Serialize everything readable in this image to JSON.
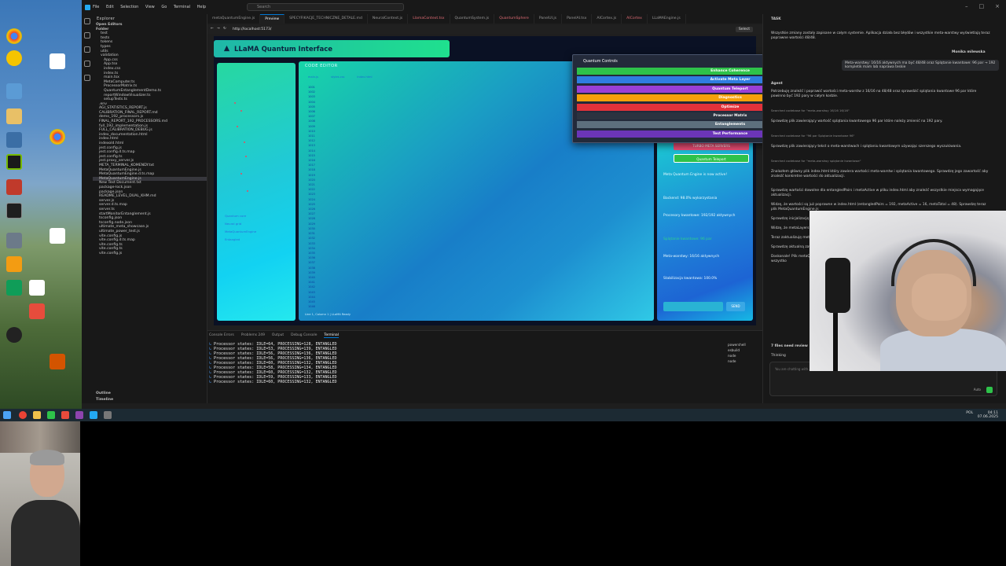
{
  "window": {
    "menu": [
      "File",
      "Edit",
      "Selection",
      "View",
      "Go",
      "Terminal",
      "Help"
    ],
    "search_placeholder": "Search"
  },
  "explorer": {
    "title": "Explorer",
    "open_editors": "Open Editors",
    "folder": "Folder",
    "files": [
      "test",
      "tests",
      "tokens",
      "types",
      "utils",
      "validation",
      "App.css",
      "App.tsx",
      "index.css",
      "index.ts",
      "main.tsx",
      "MetaComputer.ts",
      "ProcessorMatrix.ts",
      "QuantumEntanglementDemo.ts",
      "reportWindowVisualizer.ts",
      "setupTests.ts",
      ".env",
      "AGI_STATISTICS_REPORT.js",
      "CALIBRATION_FINAL_REPORT.md",
      "demo_192_processors.js",
      "FINAL_REPORT_192_PROCESSORS.md",
      "full_192_implementation.js",
      "FULL_CALIBRATION_DEBUG.js",
      "index_documentation.html",
      "index.html",
      "indexold.html",
      "jest.config.js",
      "jest.config.d.ts.map",
      "jest.config.ts",
      "jest.proxy_server.js",
      "META_TERMINAL_KOMENDY.txt",
      "MetaQuantumEngine.js",
      "MetaQuantumEngine.d.ts.map",
      "MetaQuantumEngine.js",
      "New Text Document.txt",
      "package-lock.json",
      "package.json",
      "README_LEVEL_DUAL_KHM.md",
      "server.js",
      "server.d.ts.map",
      "server.ts",
      "startMonitorEntanglement.js",
      "tsconfig.json",
      "tsconfig.node.json",
      "ultimate_meta_showcase.js",
      "ultimate_power_test.js",
      "vite.config.js",
      "vite.config.d.ts.map",
      "vite.config.ts",
      "vite.config.ts",
      "vite.config.js"
    ],
    "outline": "Outline",
    "timeline": "Timeline"
  },
  "tabs": [
    "metaQuantumEngine.js",
    "Preview",
    "SPECYFIKACJE_TECHNICZNE_DETALE.md",
    "NeuralContext.js",
    "LlamaContext.tsx",
    "QuantumSystem.js",
    "QuantumSphere",
    "PanelUI.js",
    "PanelAI.tsx",
    "AICortex.js",
    "AICortex",
    "LLaMAEngine.js"
  ],
  "browser": {
    "url": "http://localhost:5173/",
    "select_label": "Select"
  },
  "app": {
    "title": "LLaMA Quantum Interface",
    "code_editor_title": "CODE EDITOR",
    "code_editor_tabs": [
      "main.js",
      "styles.css",
      "index.html"
    ],
    "line_numbers": [
      "1001",
      "1002",
      "1003",
      "1004",
      "1005",
      "1006",
      "1007",
      "1008",
      "1009",
      "1010",
      "1011",
      "1012",
      "1013",
      "1014",
      "1015",
      "1016",
      "1017",
      "1018",
      "1019",
      "1020",
      "1021",
      "1022",
      "1023",
      "1024",
      "1025",
      "1026",
      "1027",
      "1028",
      "1029",
      "1030",
      "1031",
      "1032",
      "1033",
      "1034",
      "1035",
      "1036",
      "1037",
      "1038",
      "1039",
      "1040",
      "1041",
      "1042",
      "1043",
      "1044",
      "1045",
      "1046"
    ],
    "status": "Line 1, Column 1 | LLaMA Ready",
    "left_labels": [
      "Quantum core",
      "Neural grid",
      "MetaQuantumEngine",
      "Entangled"
    ],
    "right_panel": {
      "buttons": [
        "TURBO MODE AUTO",
        "TURBO META SERVERS",
        "Quantum Teleport"
      ],
      "items": [
        "Meta Quantum Engine is now active!",
        "Backend: 98.0% wykorzystania",
        "Procesory kwantowe: 192/192 aktywnych",
        "Splątanie kwantowe: 96 par",
        "Meta-warstwy: 16/16 aktywnych",
        "Stabilizacja kwantowa: 100.0%"
      ],
      "send": "SEND"
    }
  },
  "quantum_controls": {
    "title": "Quantum Controls",
    "items": [
      {
        "label": "Enhance Coherence",
        "color": "#2ec24a"
      },
      {
        "label": "Activate Meta Layer",
        "color": "#2f7de0"
      },
      {
        "label": "Quantum Teleport",
        "color": "#9a3fd6"
      },
      {
        "label": "Diagnostics",
        "color": "#f5a00b"
      },
      {
        "label": "Optimize",
        "color": "#e2323a"
      },
      {
        "label": "Processor Matrix",
        "color": "#2c3340"
      },
      {
        "label": "Entanglements",
        "color": "#5d6f7d"
      },
      {
        "label": "Test Performance",
        "color": "#6b35b8"
      }
    ]
  },
  "panel": {
    "tabs": [
      "Console Errors",
      "Problems",
      "Output",
      "Debug Console",
      "Terminal"
    ],
    "problems_count": "249",
    "terminal_lines": [
      "Processor states: IDLE=64, PROCESSING=128, ENTANGLED",
      "Processor states: IDLE=53, PROCESSING=139, ENTANGLED",
      "Processor states: IDLE=56, PROCESSING=136, ENTANGLED",
      "Processor states: IDLE=56, PROCESSING=136, ENTANGLED",
      "Processor states: IDLE=60, PROCESSING=132, ENTANGLED",
      "Processor states: IDLE=58, PROCESSING=134, ENTANGLED",
      "Processor states: IDLE=60, PROCESSING=132, ENTANGLED",
      "Processor states: IDLE=59, PROCESSING=133, ENTANGLED",
      "Processor states: IDLE=60, PROCESSING=132, ENTANGLED"
    ],
    "terminal_list": [
      "powershell",
      "esbuild",
      "node",
      "node"
    ]
  },
  "chat": {
    "title": "TASK",
    "intro": "Wszystkie zmiany zostały zapisane w całym systemie. Aplikacja działa bez błędów i wszystkie meta-warstwy wyświetlają teraz poprawne wartości 48/48.",
    "user_name": "Monika milewska",
    "user_msg": "Meta-warstwy: 16/16 aktywnych ma być 48/48 oraz Splątanie kwantowe: 96 par → 192 kompletik mam lab naprawa teskie",
    "agent_name": "Agent",
    "agent_lines": [
      "Potrzebuję znaleźć i poprawić wartości meta-warstw z 16/16 na 48/48 oraz sprawdzić splątania kwantowe 96 par które powinno być 192 pary w całym kodzie.",
      "Searched codebase for \"meta-warstwy 16/16 16/16\"",
      "Sprawdzę plik zawierający wartość splątania kwantowego 96 par które należy zmienić na 192 pary.",
      "Searched codebase for \"96 par Splątanie kwantowe 96\"",
      "Sprawdzę plik zawierający tekst o meta-warstwach i splątaniu kwantowym używając szerszego wyszukiwania.",
      "Searched codebase for \"meta-warstwy splątanie kwantowe\"",
      "Znalazłem główny plik index.html który zawiera wartości meta-warstw i splątania kwantowego. Sprawdzę jego zawartość aby znaleźć konkretne wartości do aktualizacji.",
      "Sprawdzę wartości dowolne dla entangledPairs i metaActive w pliku index.html aby znaleźć wszystkie miejsca wymagające aktualizacji.",
      "Widzę, że wartości są już poprawne w index.html (entangledPairs = 192, metaActive = 16, metaTotal = 48). Sprawdzę teraz plik MetaQuantumEngine.js",
      "Sprawdzę inicjalizację metaActive",
      "Widzę, że metaLayers jest ustawione na",
      "Teraz zaktualizuję metaLayers",
      "Sprawdzę aktualną zawartość",
      "Doskonale! Plik metaQuantumEngine.js zawiera aby upewnić się, że wszystko"
    ],
    "files_changed": "7 files need review",
    "thinking": "Thinking",
    "input_placeholder": "You are chatting with Agent",
    "mode": "Auto"
  },
  "taskbar": {
    "time": "04:11",
    "date": "07.06.2025",
    "lang": "POL"
  }
}
